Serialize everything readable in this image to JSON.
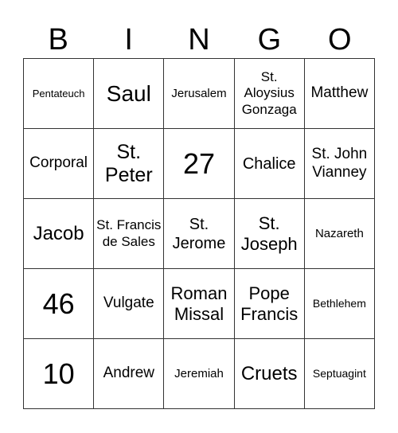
{
  "header": {
    "letters": [
      "B",
      "I",
      "N",
      "G",
      "O"
    ]
  },
  "board": {
    "rows": [
      [
        "Pentateuch",
        "Saul",
        "Jerusalem",
        "St. Aloysius Gonzaga",
        "Matthew"
      ],
      [
        "Corporal",
        "St. Peter",
        "27",
        "Chalice",
        "St. John Vianney"
      ],
      [
        "Jacob",
        "St. Francis de Sales",
        "St. Jerome",
        "St. Joseph",
        "Nazareth"
      ],
      [
        "46",
        "Vulgate",
        "Roman Missal",
        "Pope Francis",
        "Bethlehem"
      ],
      [
        "10",
        "Andrew",
        "Jeremiah",
        "Cruets",
        "Septuagint"
      ]
    ]
  }
}
